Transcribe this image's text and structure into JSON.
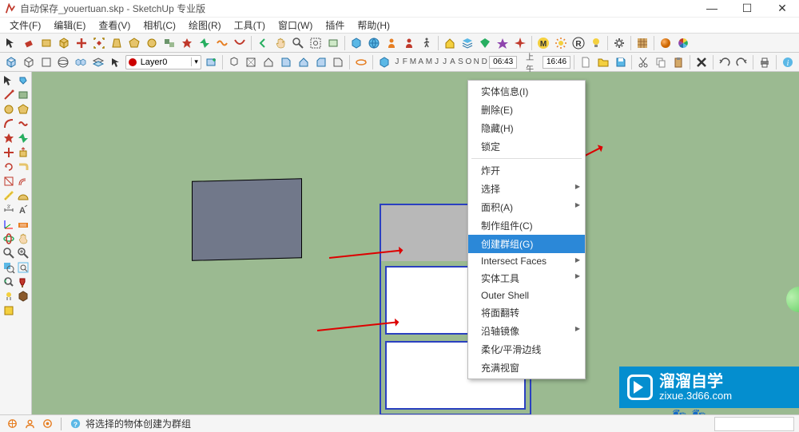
{
  "title": "自动保存_youertuan.skp - SketchUp 专业版",
  "win": {
    "min": "—",
    "max": "☐",
    "close": "✕"
  },
  "menu": [
    "文件(F)",
    "编辑(E)",
    "查看(V)",
    "相机(C)",
    "绘图(R)",
    "工具(T)",
    "窗口(W)",
    "插件",
    "帮助(H)"
  ],
  "layer": {
    "name": "Layer0"
  },
  "row2": {
    "letters": [
      "J",
      "F",
      "M",
      "A",
      "M",
      "J",
      "J",
      "A",
      "S",
      "O",
      "N",
      "D"
    ],
    "time1": "06:43",
    "ampm": "上午",
    "time2": "16:46"
  },
  "ctx": {
    "items1": [
      "实体信息(I)",
      "删除(E)",
      "隐藏(H)",
      "锁定"
    ],
    "bangkai": "炸开",
    "items2": [
      {
        "label": "选择",
        "sub": true
      },
      {
        "label": "面积(A)",
        "sub": true
      },
      {
        "label": "制作组件(C)",
        "sub": false
      },
      {
        "label": "创建群组(G)",
        "sub": false,
        "sel": true
      },
      {
        "label": "Intersect Faces",
        "sub": true
      },
      {
        "label": "实体工具",
        "sub": true
      },
      {
        "label": "Outer Shell",
        "sub": false
      },
      {
        "label": "将面翻转",
        "sub": false
      },
      {
        "label": "沿轴镜像",
        "sub": true
      },
      {
        "label": "柔化/平滑边线",
        "sub": false
      },
      {
        "label": "充满视窗",
        "sub": false
      }
    ]
  },
  "watermark": {
    "main": "溜溜自学",
    "sub": "zixue.3d66.com"
  },
  "status": {
    "text": "将选择的物体创建为群组"
  }
}
